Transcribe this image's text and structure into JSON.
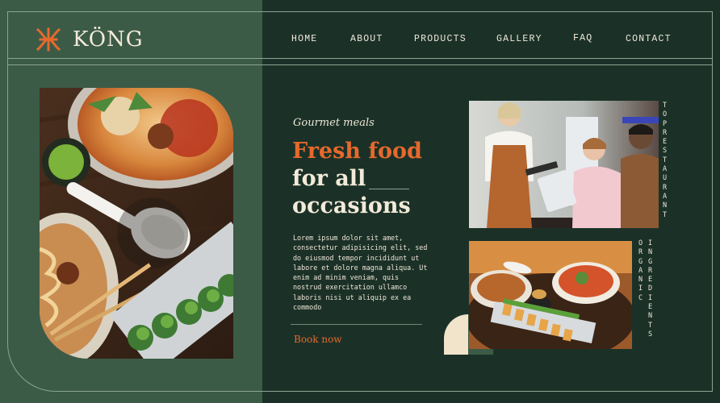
{
  "brand": {
    "name": "KÖNG",
    "logo_icon": "zhe-glyph-icon",
    "accent_color": "#e6692c"
  },
  "nav": {
    "items": [
      {
        "label": "HOME"
      },
      {
        "label": "ABOUT"
      },
      {
        "label": "PRODUCTS"
      },
      {
        "label": "GALLERY"
      },
      {
        "label": "FAQ"
      },
      {
        "label": "CONTACT"
      }
    ]
  },
  "hero": {
    "eyebrow": "Gourmet meals",
    "headline_accent": "Fresh food",
    "headline_line2": "for all",
    "headline_line3": "occasions",
    "body": "Lorem ipsum dolor sit amet, consectetur adipisicing elit, sed do eiusmod tempor incididunt ut labore et dolore magna aliqua. Ut enim ad minim veniam, quis nostrud exercitation ullamco laboris nisi ut aliquip ex ea commodo",
    "cta_label": "Book now"
  },
  "side_labels": {
    "top_restaurant": "TOP RESTAURANT",
    "organic_ingredients_1": "ORGANIC",
    "organic_ingredients_2": "INGREDIENTS"
  },
  "colors": {
    "background": "#1b3128",
    "panel": "#3c5b46",
    "cream": "#f1e4cb",
    "text": "#efe6d6"
  }
}
